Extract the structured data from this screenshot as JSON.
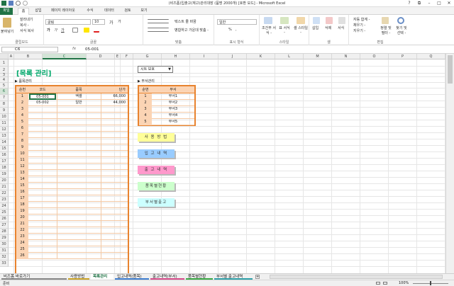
{
  "window": {
    "title": "(비즈폼)입출고(재고)관리대장 (품명 2000개) [호환 모드] - Microsoft Excel",
    "controls": [
      "?",
      "⧉",
      "–",
      "□",
      "✕"
    ]
  },
  "ribbon_tabs": [
    "파일",
    "홈",
    "삽입",
    "페이지 레이아웃",
    "수식",
    "데이터",
    "검토",
    "보기"
  ],
  "ribbon": {
    "clipboard": {
      "paste": "붙여넣기",
      "cut": "잘라내기",
      "copy": "복사 -",
      "format_painter": "서식 복사",
      "label": "클립보드"
    },
    "font": {
      "name": "굴림",
      "size": "10",
      "bold": "가",
      "italic": "가",
      "underline": "가",
      "grow": "가",
      "shrink": "가",
      "label": "글꼴"
    },
    "alignment": {
      "wrap": "텍스트 줄 바꿈",
      "merge": "병합하고 가운데 맞춤 -",
      "label": "맞춤"
    },
    "number": {
      "format": "일반",
      "percent": "%",
      "comma": ",",
      "label": "표시 형식"
    },
    "styles": {
      "cond": "조건부 서식 -",
      "table": "표 서식 -",
      "cell": "셀 스타일 -",
      "label": "스타일"
    },
    "cells": {
      "insert": "삽입",
      "delete": "삭제",
      "format": "서식",
      "label": "셀"
    },
    "editing": {
      "autosum": "자동 합계 -",
      "fill": "채우기 -",
      "clear": "지우기 -",
      "sort": "정렬 및 필터 -",
      "find": "찾기 및 선택 -",
      "label": "편집"
    }
  },
  "formula_bar": {
    "name_box": "C6",
    "fx": "fx",
    "content": "05-001"
  },
  "columns": [
    "A",
    "B",
    "C",
    "D",
    "E",
    "F",
    "G",
    "H",
    "I",
    "J",
    "K",
    "L",
    "M",
    "N",
    "O",
    "P",
    "Q",
    "R"
  ],
  "rows": [
    "1",
    "2",
    "3",
    "4",
    "5",
    "6",
    "7",
    "8",
    "9",
    "10",
    "11",
    "12",
    "13",
    "14",
    "15",
    "16",
    "17",
    "18",
    "19",
    "20",
    "21",
    "22",
    "23",
    "24",
    "25",
    "26",
    "27",
    "28",
    "29",
    "30",
    "31",
    "32",
    "33"
  ],
  "sheet": {
    "title": "[목록 관리]",
    "protect": "시트 보호",
    "left_heading": "▶ 품목관리",
    "right_heading": "▶ 부서관리",
    "product_table": {
      "headers": [
        "순번",
        "코드",
        "품목",
        "단가"
      ],
      "rows": [
        [
          "1",
          "05-001",
          "엑셀",
          "66,000"
        ],
        [
          "2",
          "05-002",
          "일반",
          "44,000"
        ]
      ],
      "numbers": [
        "1",
        "2",
        "3",
        "4",
        "5",
        "6",
        "7",
        "8",
        "9",
        "10",
        "11",
        "12",
        "13",
        "14",
        "15",
        "16",
        "17",
        "18",
        "19",
        "20",
        "21",
        "22",
        "23",
        "24",
        "25",
        "26"
      ]
    },
    "dept_table": {
      "headers": [
        "순번",
        "부서"
      ],
      "rows": [
        [
          "1",
          "부서1"
        ],
        [
          "2",
          "부서2"
        ],
        [
          "3",
          "부서3"
        ],
        [
          "4",
          "부서4"
        ],
        [
          "5",
          "부서5"
        ]
      ]
    },
    "buttons": [
      {
        "label": "사 용 방 법",
        "color": "#ffff99"
      },
      {
        "label": "입 고 내 역",
        "color": "#99ccff"
      },
      {
        "label": "출 고 내 역",
        "color": "#ff99cc"
      },
      {
        "label": "품목별현황",
        "color": "#ccffcc"
      },
      {
        "label": "부서별출고",
        "color": "#ccffff"
      }
    ]
  },
  "sheet_tabs": [
    {
      "label": "비즈폼 바로가기",
      "color": "#888888"
    },
    {
      "label": "사용방법",
      "color": "#c9a227"
    },
    {
      "label": "목록관리",
      "color": "#ffffff"
    },
    {
      "label": "입고내역(품목)",
      "color": "#3f7ecf"
    },
    {
      "label": "출고내역(부서)",
      "color": "#d64c8a"
    },
    {
      "label": "품목별현황",
      "color": "#3aa845"
    },
    {
      "label": "부서별 출고내역",
      "color": "#2fa0a8"
    }
  ],
  "status": {
    "ready": "준비",
    "zoom": "100%"
  },
  "colors": {
    "accent": "#217346",
    "header_fill": "#fbd4b4",
    "table_border": "#e8832f"
  }
}
